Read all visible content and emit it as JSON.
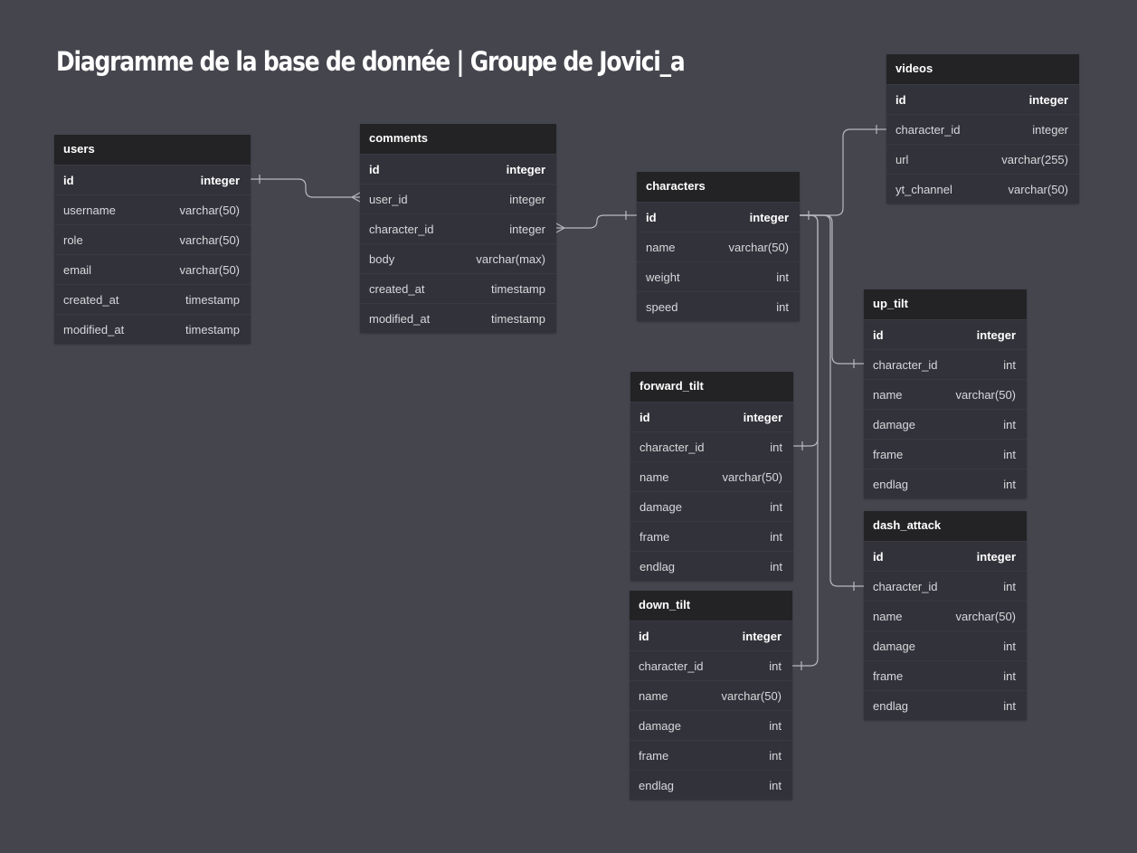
{
  "title": "Diagramme de la base de donnée | Groupe de Jovici_a",
  "tables": {
    "users": {
      "name": "users",
      "columns": [
        {
          "name": "id",
          "type": "integer"
        },
        {
          "name": "username",
          "type": "varchar(50)"
        },
        {
          "name": "role",
          "type": "varchar(50)"
        },
        {
          "name": "email",
          "type": "varchar(50)"
        },
        {
          "name": "created_at",
          "type": "timestamp"
        },
        {
          "name": "modified_at",
          "type": "timestamp"
        }
      ]
    },
    "comments": {
      "name": "comments",
      "columns": [
        {
          "name": "id",
          "type": "integer"
        },
        {
          "name": "user_id",
          "type": "integer"
        },
        {
          "name": "character_id",
          "type": "integer"
        },
        {
          "name": "body",
          "type": "varchar(max)"
        },
        {
          "name": "created_at",
          "type": "timestamp"
        },
        {
          "name": "modified_at",
          "type": "timestamp"
        }
      ]
    },
    "characters": {
      "name": "characters",
      "columns": [
        {
          "name": "id",
          "type": "integer"
        },
        {
          "name": "name",
          "type": "varchar(50)"
        },
        {
          "name": "weight",
          "type": "int"
        },
        {
          "name": "speed",
          "type": "int"
        }
      ]
    },
    "videos": {
      "name": "videos",
      "columns": [
        {
          "name": "id",
          "type": "integer"
        },
        {
          "name": "character_id",
          "type": "integer"
        },
        {
          "name": "url",
          "type": "varchar(255)"
        },
        {
          "name": "yt_channel",
          "type": "varchar(50)"
        }
      ]
    },
    "up_tilt": {
      "name": "up_tilt",
      "columns": [
        {
          "name": "id",
          "type": "integer"
        },
        {
          "name": "character_id",
          "type": "int"
        },
        {
          "name": "name",
          "type": "varchar(50)"
        },
        {
          "name": "damage",
          "type": "int"
        },
        {
          "name": "frame",
          "type": "int"
        },
        {
          "name": "endlag",
          "type": "int"
        }
      ]
    },
    "forward_tilt": {
      "name": "forward_tilt",
      "columns": [
        {
          "name": "id",
          "type": "integer"
        },
        {
          "name": "character_id",
          "type": "int"
        },
        {
          "name": "name",
          "type": "varchar(50)"
        },
        {
          "name": "damage",
          "type": "int"
        },
        {
          "name": "frame",
          "type": "int"
        },
        {
          "name": "endlag",
          "type": "int"
        }
      ]
    },
    "down_tilt": {
      "name": "down_tilt",
      "columns": [
        {
          "name": "id",
          "type": "integer"
        },
        {
          "name": "character_id",
          "type": "int"
        },
        {
          "name": "name",
          "type": "varchar(50)"
        },
        {
          "name": "damage",
          "type": "int"
        },
        {
          "name": "frame",
          "type": "int"
        },
        {
          "name": "endlag",
          "type": "int"
        }
      ]
    },
    "dash_attack": {
      "name": "dash_attack",
      "columns": [
        {
          "name": "id",
          "type": "integer"
        },
        {
          "name": "character_id",
          "type": "int"
        },
        {
          "name": "name",
          "type": "varchar(50)"
        },
        {
          "name": "damage",
          "type": "int"
        },
        {
          "name": "frame",
          "type": "int"
        },
        {
          "name": "endlag",
          "type": "int"
        }
      ]
    }
  }
}
